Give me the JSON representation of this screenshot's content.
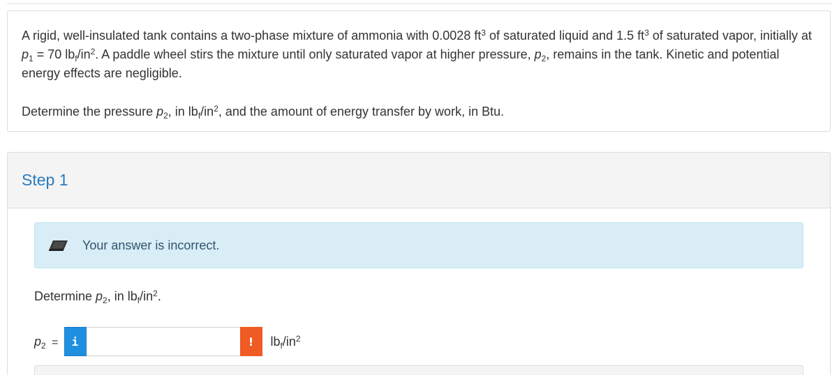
{
  "problem": {
    "s1": "A rigid, well-insulated tank contains a two-phase mixture of ammonia with 0.0028 ft",
    "s2": " of saturated liquid and 1.5 ft",
    "s3": " of saturated vapor, initially at ",
    "s4": " = 70 lb",
    "s5": "/in",
    "s6": ". A paddle wheel stirs the mixture until only saturated vapor at higher pressure, ",
    "s7": ", remains in the tank. Kinetic and potential energy effects are negligible.",
    "q1": "Determine the pressure ",
    "q2": ", in lb",
    "q3": "/in",
    "q4": ", and the amount of energy transfer by work, in Btu."
  },
  "sym": {
    "p": "p",
    "one": "1",
    "two": "2",
    "three": "3",
    "f": "f"
  },
  "step": {
    "title": "Step 1",
    "alert_text": "Your answer is incorrect.",
    "alert_icon": "eraser-icon",
    "prompt_a": "Determine ",
    "prompt_b": ", in lb",
    "prompt_c": "/in",
    "prompt_d": ".",
    "var_eq": " =",
    "info_glyph": "i",
    "warn_glyph": "!",
    "input_value": "",
    "unit_a": "lb",
    "unit_b": "/in"
  },
  "colors": {
    "step_title": "#2a7bbd",
    "alert_bg": "#d9edf7",
    "info_btn": "#1f8fe0",
    "warn_btn": "#f05a23"
  }
}
